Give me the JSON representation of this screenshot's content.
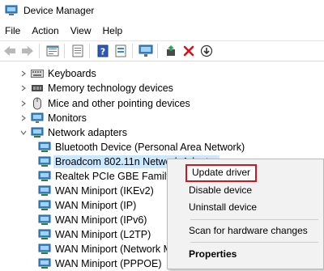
{
  "window": {
    "title": "Device Manager",
    "icon": "device-manager-icon"
  },
  "menu": [
    "File",
    "Action",
    "View",
    "Help"
  ],
  "toolbar": [
    "back-icon",
    "forward-icon",
    "properties-icon",
    "show-hide-icon",
    "help-icon",
    "monitor-icon",
    "update-driver-icon",
    "uninstall-icon",
    "download-icon"
  ],
  "tree": [
    {
      "label": "Keyboards",
      "icon": "keyboard-icon",
      "level": 1,
      "expander": "collapsed"
    },
    {
      "label": "Memory technology devices",
      "icon": "memory-icon",
      "level": 1,
      "expander": "collapsed"
    },
    {
      "label": "Mice and other pointing devices",
      "icon": "mouse-icon",
      "level": 1,
      "expander": "collapsed"
    },
    {
      "label": "Monitors",
      "icon": "monitor-icon",
      "level": 1,
      "expander": "collapsed"
    },
    {
      "label": "Network adapters",
      "icon": "network-adapter-icon",
      "level": 1,
      "expander": "expanded"
    },
    {
      "label": "Bluetooth Device (Personal Area Network)",
      "icon": "network-adapter-icon",
      "level": 2
    },
    {
      "label": "Broadcom 802.11n Network Adapter",
      "icon": "network-adapter-icon",
      "level": 2,
      "selected": true
    },
    {
      "label": "Realtek PCIe GBE Family Controller",
      "icon": "network-adapter-icon",
      "level": 2
    },
    {
      "label": "WAN Miniport (IKEv2)",
      "icon": "network-adapter-icon",
      "level": 2
    },
    {
      "label": "WAN Miniport (IP)",
      "icon": "network-adapter-icon",
      "level": 2
    },
    {
      "label": "WAN Miniport (IPv6)",
      "icon": "network-adapter-icon",
      "level": 2
    },
    {
      "label": "WAN Miniport (L2TP)",
      "icon": "network-adapter-icon",
      "level": 2
    },
    {
      "label": "WAN Miniport (Network Monitor)",
      "icon": "network-adapter-icon",
      "level": 2
    },
    {
      "label": "WAN Miniport (PPPOE)",
      "icon": "network-adapter-icon",
      "level": 2
    }
  ],
  "context_menu": {
    "items": [
      {
        "label": "Update driver",
        "highlighted": true
      },
      {
        "label": "Disable device"
      },
      {
        "label": "Uninstall device"
      },
      {
        "label": "Scan for hardware changes"
      },
      {
        "label": "Properties",
        "bold": true
      }
    ]
  },
  "colors": {
    "highlight_border": "#d6141a",
    "selection": "#cce8ff",
    "menu_bg": "#f2f2f2"
  }
}
